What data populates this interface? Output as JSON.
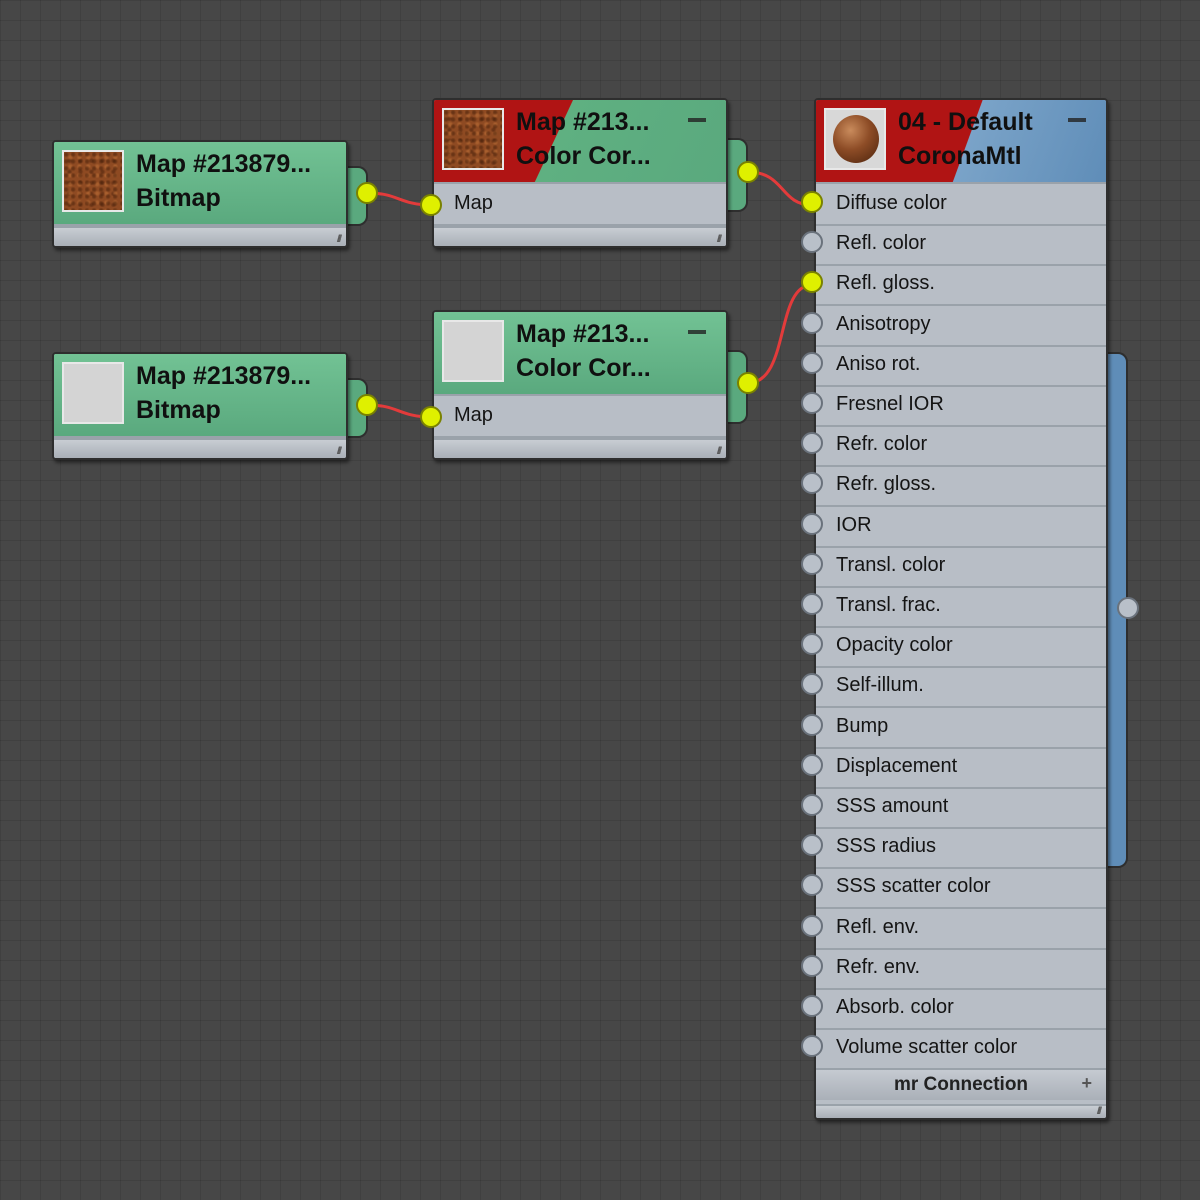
{
  "nodes": {
    "bitmap1": {
      "title": "Map #213879...",
      "subtitle": "Bitmap",
      "thumbnail": "brown-noise-texture"
    },
    "bitmap2": {
      "title": "Map #213879...",
      "subtitle": "Bitmap",
      "thumbnail": "light-grey-texture"
    },
    "colorcorrect1": {
      "title": "Map #213...",
      "subtitle": "Color Cor...",
      "slot": "Map",
      "thumbnail": "brown-noise-texture"
    },
    "colorcorrect2": {
      "title": "Map #213...",
      "subtitle": "Color Cor...",
      "slot": "Map",
      "thumbnail": "light-grey-texture"
    },
    "material": {
      "title": "04 - Default",
      "subtitle": "CoronaMtl",
      "thumbnail": "brown-sphere-preview",
      "slots": [
        "Diffuse color",
        "Refl. color",
        "Refl. gloss.",
        "Anisotropy",
        "Aniso rot.",
        "Fresnel IOR",
        "Refr. color",
        "Refr. gloss.",
        "IOR",
        "Transl. color",
        "Transl. frac.",
        "Opacity color",
        "Self-illum.",
        "Bump",
        "Displacement",
        "SSS amount",
        "SSS radius",
        "SSS scatter color",
        "Refl. env.",
        "Refr. env.",
        "Absorb. color",
        "Volume scatter color"
      ],
      "connected_slots": [
        "Diffuse color",
        "Refl. gloss."
      ],
      "rollout": "mr Connection"
    }
  },
  "colors": {
    "canvas": "#474747",
    "map_header": "#5aa97e",
    "material_header": "#5f8db8",
    "active_port": "#dff000",
    "wire": "#e33b3b",
    "node_body": "#b8bec6"
  },
  "icons": {
    "minimize": "minimize-icon",
    "expand": "plus-icon",
    "resize": "resize-grip-icon"
  }
}
